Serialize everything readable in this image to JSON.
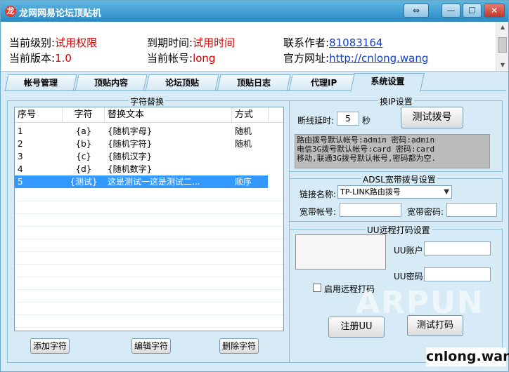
{
  "window": {
    "title": "龙网网易论坛顶贴机",
    "app_icon": "dragon-logo-icon",
    "restore_icon": "⇔",
    "minimize_icon": "—",
    "maximize_icon": "☐",
    "close_icon": "✕"
  },
  "info": {
    "level_label": "当前级别:",
    "level_value": "试用权限",
    "expire_label": "到期时间:",
    "expire_value": "试用时间",
    "contact_label": "联系作者:",
    "contact_value": "81083164",
    "version_label": "当前版本:",
    "version_value": "1.0",
    "account_label": "当前帐号:",
    "account_value": "long",
    "website_label": "官方网址:",
    "website_value": "http://cnlong.wang"
  },
  "tabs": [
    {
      "label": "帐号管理"
    },
    {
      "label": "顶贴内容"
    },
    {
      "label": "论坛顶贴"
    },
    {
      "label": "顶贴日志"
    },
    {
      "label": "代理IP"
    },
    {
      "label": "系统设置"
    }
  ],
  "active_tab": "系统设置",
  "char_replace": {
    "title": "字符替换",
    "columns": [
      "序号",
      "字符",
      "替换文本",
      "方式"
    ],
    "rows": [
      {
        "no": "1",
        "char": "{a}",
        "text": "{随机字母}",
        "mode": "随机"
      },
      {
        "no": "2",
        "char": "{b}",
        "text": "{随机字符}",
        "mode": "随机"
      },
      {
        "no": "3",
        "char": "{c}",
        "text": "{随机汉字}",
        "mode": ""
      },
      {
        "no": "4",
        "char": "{d}",
        "text": "{随机数字}",
        "mode": ""
      },
      {
        "no": "5",
        "char": "{测试}",
        "text": "这是测试一这是测试二...",
        "mode": "顺序"
      }
    ],
    "selected_row": "5",
    "add_button": "添加字符",
    "edit_button": "编辑字符",
    "delete_button": "删除字符"
  },
  "ip_settings": {
    "title": "换IP设置",
    "delay_label": "断线延时:",
    "delay_value": "5",
    "delay_unit": "秒",
    "test_dial_button": "测试拨号",
    "info_lines": [
      "路由拨号默认帐号:admin 密码:admin",
      "电信3G拨号默认帐号:card 密码:card",
      "移动,联通3G拨号默认帐号,密码都为空."
    ]
  },
  "adsl": {
    "title": "ADSL宽带拨号设置",
    "conn_label": "链接名称:",
    "conn_value": "TP-LINK路由拨号",
    "account_label": "宽带帐号:",
    "account_value": "",
    "password_label": "宽带密码:",
    "password_value": ""
  },
  "uu": {
    "title": "UU远程打码设置",
    "account_label": "UU账户:",
    "password_label": "UU密码:",
    "remote_checkbox_label": "启用远程打码",
    "register_button": "注册UU",
    "test_button": "测试打码"
  },
  "watermark": {
    "big": "ARPUN",
    "site": "cnlong.wang"
  },
  "colors": {
    "accent": "#2a89c4",
    "red_text": "#d40000",
    "link": "#1240c8",
    "selection": "#3399ff"
  }
}
